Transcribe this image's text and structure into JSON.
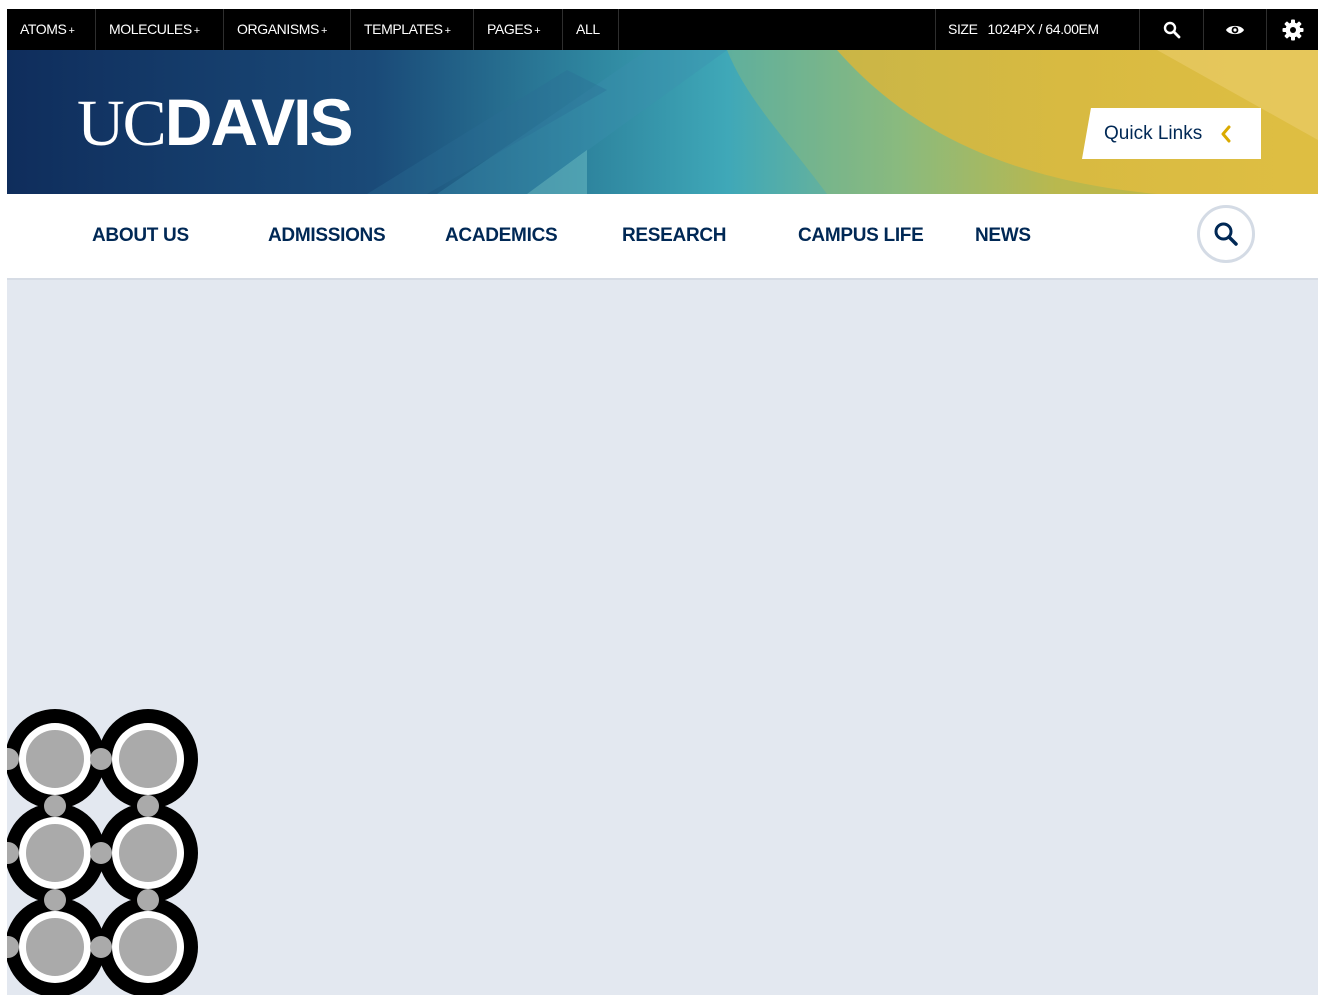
{
  "toolbar": {
    "menus": [
      {
        "label": "ATOMS",
        "suffix": "+"
      },
      {
        "label": "MOLECULES",
        "suffix": "+"
      },
      {
        "label": "ORGANISMS",
        "suffix": "+"
      },
      {
        "label": "TEMPLATES",
        "suffix": "+"
      },
      {
        "label": "PAGES",
        "suffix": "+"
      },
      {
        "label": "ALL",
        "suffix": ""
      }
    ],
    "size_label": "SIZE",
    "size_value": "1024PX / 64.00EM",
    "icons": [
      "search-icon",
      "eye-icon",
      "gear-icon"
    ]
  },
  "header": {
    "logo_uc": "UC",
    "logo_davis": "DAVIS",
    "quick_links_label": "Quick Links",
    "quick_links_icon": "chevron-left-icon"
  },
  "nav": {
    "items": [
      {
        "label": "ABOUT US"
      },
      {
        "label": "ADMISSIONS"
      },
      {
        "label": "ACADEMICS"
      },
      {
        "label": "RESEARCH"
      },
      {
        "label": "CAMPUS LIFE"
      },
      {
        "label": "NEWS"
      }
    ],
    "search_icon": "search-icon"
  },
  "colors": {
    "toolbar_bg": "#000000",
    "navy": "#002855",
    "gold": "#daaa00",
    "content_bg": "#e3e8f0",
    "divider": "#d6dce5"
  },
  "loading_indicator": {
    "icon": "ring-pattern-icon"
  }
}
